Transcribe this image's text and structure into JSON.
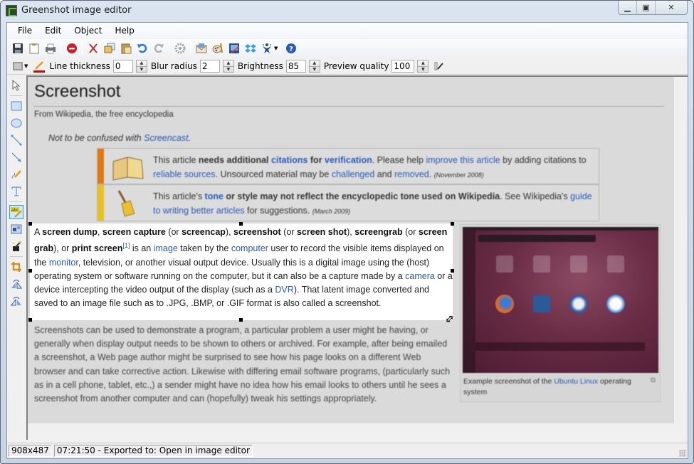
{
  "window": {
    "title": "Greenshot image editor",
    "controls": [
      "minimize",
      "maximize",
      "close"
    ]
  },
  "menu": [
    "File",
    "Edit",
    "Object",
    "Help"
  ],
  "toolbar_main": [
    "save-icon",
    "clipboard-icon",
    "print-icon",
    "|",
    "delete-icon",
    "|",
    "cut-icon",
    "copy-icon",
    "paste-icon",
    "undo-icon",
    "redo-icon",
    "|",
    "settings-icon",
    "|",
    "email-icon",
    "paint-icon",
    "office-icon",
    "dropbox-icon",
    "imgur-icon",
    "|",
    "help-icon"
  ],
  "toolbar_props": {
    "line_thickness_label": "Line thickness",
    "line_thickness_value": "0",
    "blur_radius_label": "Blur radius",
    "blur_radius_value": "2",
    "brightness_label": "Brightness",
    "brightness_value": "85",
    "preview_quality_label": "Preview quality",
    "preview_quality_value": "100",
    "line_color": "#e00000"
  },
  "left_tools": [
    {
      "name": "select",
      "active": false
    },
    {
      "name": "rectangle",
      "active": false
    },
    {
      "name": "ellipse",
      "active": false
    },
    {
      "name": "line",
      "active": false
    },
    {
      "name": "arrow",
      "active": false
    },
    {
      "name": "freehand",
      "active": false
    },
    {
      "name": "text",
      "active": false
    },
    {
      "name": "highlight",
      "active": true
    },
    {
      "name": "obfuscate",
      "active": false
    },
    {
      "name": "effects",
      "active": false
    },
    {
      "name": "crop",
      "active": false
    },
    {
      "name": "rotate-cw",
      "active": false
    },
    {
      "name": "rotate-ccw",
      "active": false
    }
  ],
  "canvas": {
    "article_title": "Screenshot",
    "from": "From Wikipedia, the free encyclopedia",
    "hatnote_prefix": "Not to be confused with ",
    "hatnote_link": "Screencast",
    "ambox1": {
      "t1": "This article ",
      "b1": "needs additional ",
      "l1": "citations",
      "b2": " for ",
      "l2": "verification",
      "t2": ". Please help ",
      "l3": "improve this article",
      "t3": " by adding citations to ",
      "l4": "reliable sources",
      "t4": ". Unsourced material may be ",
      "l5": "challenged",
      "t5": " and ",
      "l6": "removed",
      "t6": ". ",
      "date": "(November 2008)"
    },
    "ambox2": {
      "t1": "This article's ",
      "l1": "tone",
      "b1": " or style may not reflect the encyclopedic tone used on Wikipedia",
      "t2": ". See Wikipedia's ",
      "l2": "guide to writing better articles",
      "t3": " for suggestions. ",
      "date": "(March 2009)"
    },
    "lead": {
      "p1": "A ",
      "b1": "screen dump",
      "p2": ", ",
      "b2": "screen capture",
      "p3": " (or ",
      "b3": "screencap",
      "p4": "), ",
      "b4": "screenshot",
      "p5": " (or ",
      "b5": "screen shot",
      "p6": "), ",
      "b6": "screengrab",
      "p7": " (or ",
      "b7": "screen grab",
      "p8": "), or ",
      "b8": "print screen",
      "sup": "[1]",
      "p9": " is an ",
      "l1": "image",
      "p10": " taken by the ",
      "l2": "computer",
      "p11": " user to record the visible items displayed on the ",
      "l3": "monitor",
      "p12": ", television, or another visual output device. Usually this is a digital image using the (host) operating system or software running on the computer, but it can also be a capture made by a ",
      "l4": "camera",
      "p13": " or a device intercepting the video output of the display (such as a ",
      "l5": "DVR",
      "p14": "). That latent image converted and saved to an image file such as to .JPG, .BMP, or .GIF format is also called a screenshot."
    },
    "para2": "Screenshots can be used to demonstrate a program, a particular problem a user might be having, or generally when display output needs to be shown to others or archived. For example, after being emailed a screenshot, a Web page author might be surprised to see how his page looks on a different Web browser and can take corrective action. Likewise with differing email software programs, (particularly such as in a cell phone, tablet, etc.,) a sender might have no idea how his email looks to others until he sees a screenshot from another computer and can (hopefully) tweak his settings appropriately.",
    "caption_prefix": "Example screenshot of the ",
    "caption_link": "Ubuntu Linux",
    "caption_suffix": " operating system"
  },
  "status": {
    "dimensions": "908x487",
    "message": "07:21:50 - Exported to: Open in image editor"
  }
}
